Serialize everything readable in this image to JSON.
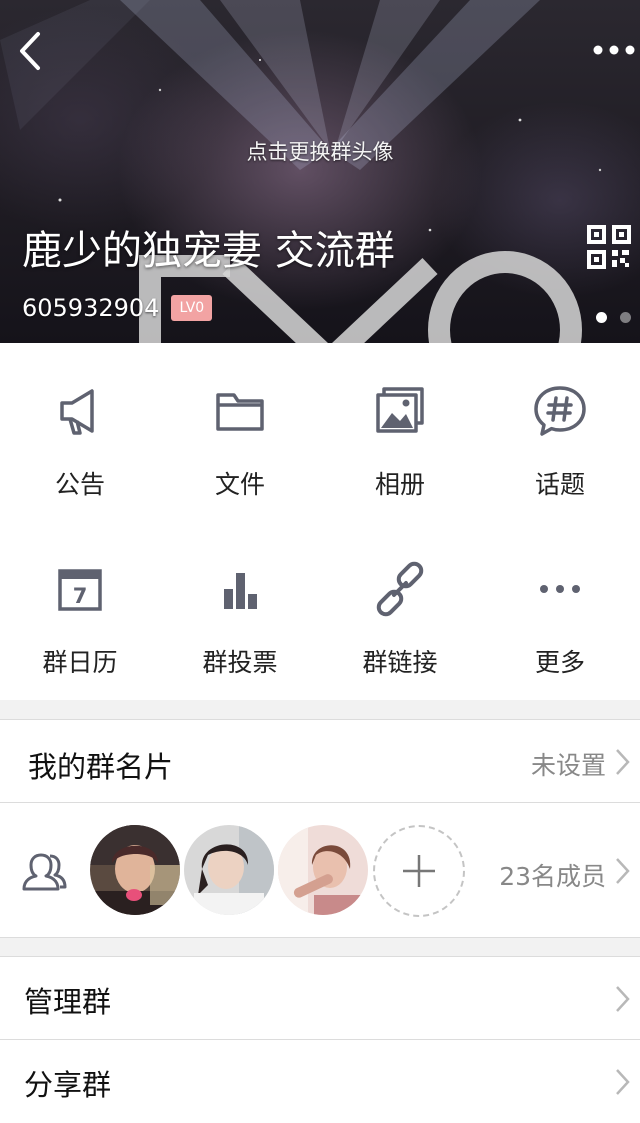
{
  "header": {
    "change_avatar_text": "点击更换群头像",
    "group_name": "鹿少的独宠妻 交流群",
    "group_id": "605932904",
    "level": "LV0",
    "background_letters": "EXO"
  },
  "features": [
    {
      "label": "公告",
      "icon": "megaphone-icon"
    },
    {
      "label": "文件",
      "icon": "folder-icon"
    },
    {
      "label": "相册",
      "icon": "album-icon"
    },
    {
      "label": "话题",
      "icon": "topic-hash-icon"
    },
    {
      "label": "群日历",
      "icon": "calendar-icon",
      "calendar_day": "7"
    },
    {
      "label": "群投票",
      "icon": "bar-chart-icon"
    },
    {
      "label": "群链接",
      "icon": "link-icon"
    },
    {
      "label": "更多",
      "icon": "more-dots-icon"
    }
  ],
  "card": {
    "title": "我的群名片",
    "value": "未设置"
  },
  "members": {
    "count_label": "23名成员",
    "avatars": [
      "member-avatar-1",
      "member-avatar-2",
      "member-avatar-3"
    ]
  },
  "menu": [
    {
      "label": "管理群"
    },
    {
      "label": "分享群"
    }
  ],
  "colors": {
    "icon": "#5f6270",
    "badge": "#f2a3a3",
    "text_secondary": "#888888"
  }
}
